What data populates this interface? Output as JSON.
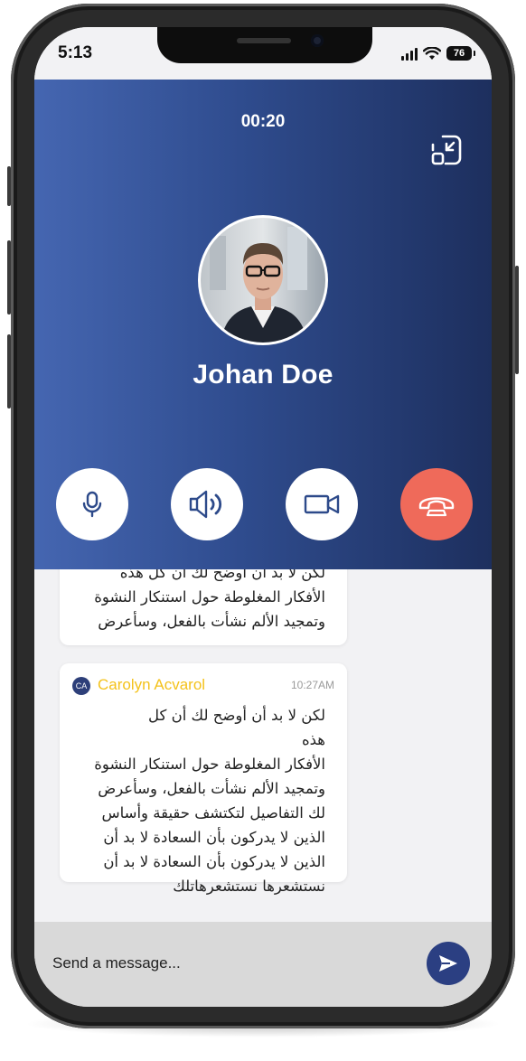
{
  "status_bar": {
    "time": "5:13",
    "battery": "76",
    "icons": [
      "signal-icon",
      "wifi-icon",
      "battery-icon"
    ]
  },
  "call": {
    "timer": "00:20",
    "caller_name": "Johan Doe",
    "controls": [
      "microphone-icon",
      "speaker-icon",
      "video-camera-icon",
      "end-call-icon"
    ],
    "colors": {
      "gradient_start": "#4566b1",
      "gradient_end": "#1d2f5e",
      "end_call": "#ef6a5a"
    }
  },
  "messages": [
    {
      "lines": [
        "لكن لا بد أن أوضح لك أن كل هذه",
        "الأفكار المغلوطة حول استنكار  النشوة",
        "وتمجيد الألم نشأت بالفعل، وسأعرض"
      ]
    },
    {
      "sender_initials": "CA",
      "sender": "Carolyn Acvarol",
      "time": "10:27AM",
      "lines": [
        "لكن لا بد أن أوضح لك أن كل",
        "هذه",
        "الأفكار المغلوطة حول استنكار  النشوة",
        "وتمجيد الألم نشأت بالفعل، وسأعرض",
        "لك التفاصيل لتكتشف حقيقة وأساس",
        "الذين لا يدركون بأن السعادة لا بد أن",
        "الذين لا يدركون بأن السعادة لا بد أن",
        "نستشعرها  نستشعرهاتلك"
      ]
    }
  ],
  "composer": {
    "placeholder": "Send a message...",
    "send_icon": "send-icon",
    "send_color": "#2b3f82"
  }
}
